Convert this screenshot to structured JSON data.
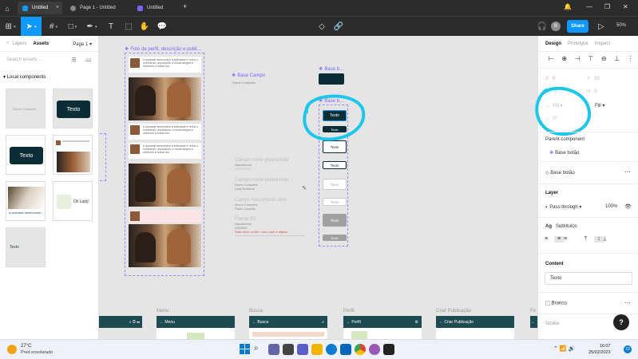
{
  "tabs": [
    {
      "label": "Untitled",
      "active": true
    },
    {
      "label": "Page 1 - Untitled",
      "active": false
    },
    {
      "label": "Untitled",
      "active": false
    }
  ],
  "new_tab": "+",
  "toolbar": {
    "share_label": "Share",
    "zoom": "50%",
    "avatar_letter": "B"
  },
  "left_panel": {
    "tab_layers": "Layers",
    "tab_assets": "Assets",
    "page_selector": "Page 1",
    "search_placeholder": "Search assets...",
    "section_title": "Local components",
    "thumb_button_text": "Texto",
    "thumb_teal_text": "Texto",
    "thumb_dog_caption": "Oii Lady!"
  },
  "canvas": {
    "frame_foto": "Foto de perfil, descrição e publi...",
    "frame_base_campo": "Base Campo",
    "base_campo_sub": "Nome Completo",
    "frame_base_b": "Base b...",
    "frame_base_b2": "Base b...",
    "post_text": "A amizade desenvolve a felicidade e reduz o sofrimento, duplicando a nossa alegria e dividindo a nossa dor.",
    "button_label": "Texto",
    "fields": [
      {
        "title": "Campo nome preenchido",
        "lines": [
          "Nascimento",
          "00/00/0000"
        ]
      },
      {
        "title": "Campo nome preenchido",
        "lines": [
          "Nome Completo",
          "Lady Bertamé"
        ]
      },
      {
        "title": "Campo nascimento zero",
        "lines": [
          "Nome Completo",
          "Paulo Cupertin"
        ]
      },
      {
        "title": "Frame 33",
        "lines": [
          "Nascimento",
          "00/00/00"
        ],
        "error": "Data deve conter o ano com 4 digitos"
      }
    ],
    "mobile_frames": [
      {
        "label": "Menu",
        "bar": "Menu"
      },
      {
        "label": "Busca",
        "bar": "Busca"
      },
      {
        "label": "Perfil",
        "bar": "Perfil"
      },
      {
        "label": "Criar Publicação",
        "bar": "Criar Publicação"
      },
      {
        "label": "Fe",
        "bar": ""
      }
    ]
  },
  "right_panel": {
    "tab_design": "Design",
    "tab_prototype": "Prototype",
    "tab_inspect": "Inspect",
    "x_label": "X",
    "x_value": "0",
    "y_label": "Y",
    "y_value": "30",
    "w_label": "W",
    "w_value": "0",
    "h_label": "H",
    "h_value": "0",
    "fill_left": "Fill",
    "fill_right": "Fill",
    "radius_label": "0°",
    "parent_component_title": "Parent component",
    "parent_component_name": "Base botão",
    "component_name": "Base botão",
    "layer_title": "Layer",
    "layer_blend": "Pass through",
    "layer_opacity": "100%",
    "text_style": "Subtítulos",
    "content_title": "Content",
    "content_value": "Texto",
    "fill_name": "Branco",
    "stroke_label": "Stroke",
    "help": "?"
  },
  "taskbar": {
    "weather_temp": "27°C",
    "weather_desc": "Pred ensolarado",
    "time": "16:07",
    "date": "25/02/2023",
    "notifications": "23"
  },
  "colors": {
    "accent": "#0d99ff",
    "component_purple": "#7b61ff",
    "button_dark": "#0b2e36",
    "app_bar": "#1e4a52"
  }
}
